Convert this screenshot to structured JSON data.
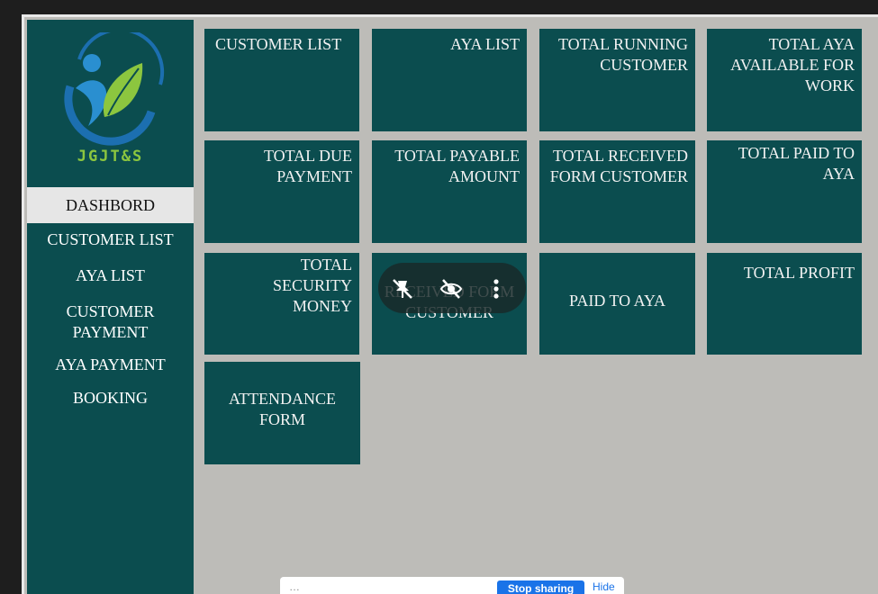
{
  "brand": {
    "name": "JGJT&S"
  },
  "sidebar": {
    "items": [
      {
        "label": "DASHBORD"
      },
      {
        "label": "CUSTOMER LIST"
      },
      {
        "label": "AYA LIST"
      },
      {
        "label": "CUSTOMER PAYMENT"
      },
      {
        "label": "AYA PAYMENT"
      },
      {
        "label": "BOOKING"
      }
    ]
  },
  "tiles": [
    {
      "label": "CUSTOMER LIST"
    },
    {
      "label": "AYA LIST"
    },
    {
      "label": "TOTAL RUNNING CUSTOMER"
    },
    {
      "label": "TOTAL AYA AVAILABLE FOR WORK"
    },
    {
      "label": "TOTAL DUE PAYMENT"
    },
    {
      "label": "TOTAL PAYABLE AMOUNT"
    },
    {
      "label": "TOTAL RECEIVED FORM CUSTOMER"
    },
    {
      "label": "TOTAL PAID TO AYA"
    },
    {
      "label": "TOTAL SECURITY MONEY"
    },
    {
      "label": "RECEIVED FORM CUSTOMER"
    },
    {
      "label": "PAID TO AYA"
    },
    {
      "label": "TOTAL PROFIT"
    },
    {
      "label": "ATTENDANCE FORM"
    }
  ],
  "overlay": {
    "icons": [
      "unpin-icon",
      "visibility-off-icon",
      "more-vert-icon"
    ]
  },
  "bottom_bar": {
    "message": "…",
    "button": "Stop sharing",
    "hide": "Hide"
  },
  "colors": {
    "tile": "#0b4d4f",
    "background": "#bdbcb8",
    "brand_green": "#8cc63f",
    "brand_blue": "#1c6fb0"
  }
}
